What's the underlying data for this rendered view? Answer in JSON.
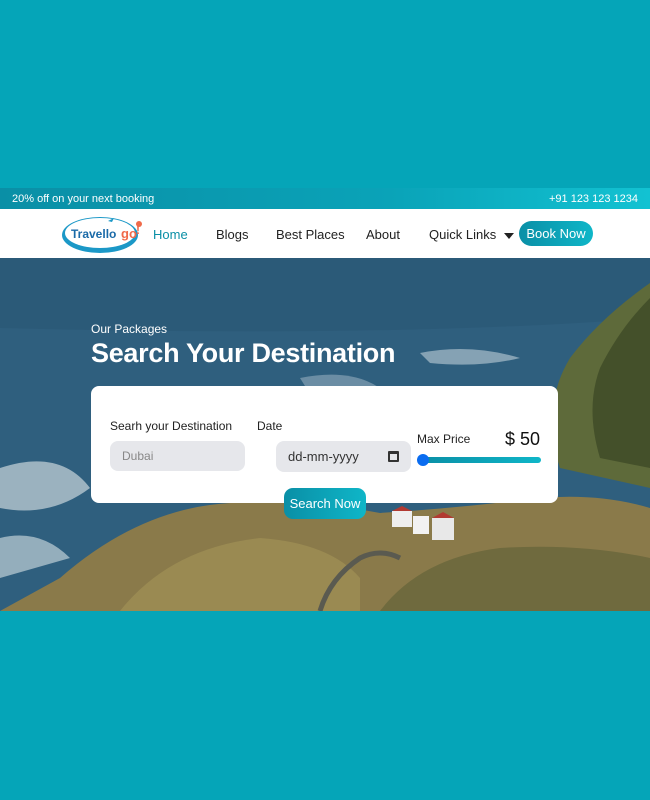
{
  "topbar": {
    "promo": "20% off on your next booking",
    "phone": "+91 123 123 1234"
  },
  "nav": {
    "logo_text": "Travellogo",
    "logo_suffix": "!",
    "links": [
      "Home",
      "Blogs",
      "Best Places",
      "About",
      "Quick Links"
    ],
    "book_now": "Book Now"
  },
  "hero": {
    "eyebrow": "Our Packages",
    "title": "Search Your Destination"
  },
  "search": {
    "destination_label": "Searh your Destination",
    "destination_placeholder": "Dubai",
    "date_label": "Date",
    "date_placeholder": "dd-mm-yyyy",
    "price_label": "Max Price",
    "price_value": "$ 50",
    "slider_fraction": 0.0,
    "button": "Search Now"
  },
  "colors": {
    "background": "#05a5b8",
    "accent": "#0a8fa6",
    "slider_thumb": "#0a6cf0"
  },
  "icons": [
    "calendar-icon",
    "caret-down-icon",
    "map-pin-icon"
  ]
}
